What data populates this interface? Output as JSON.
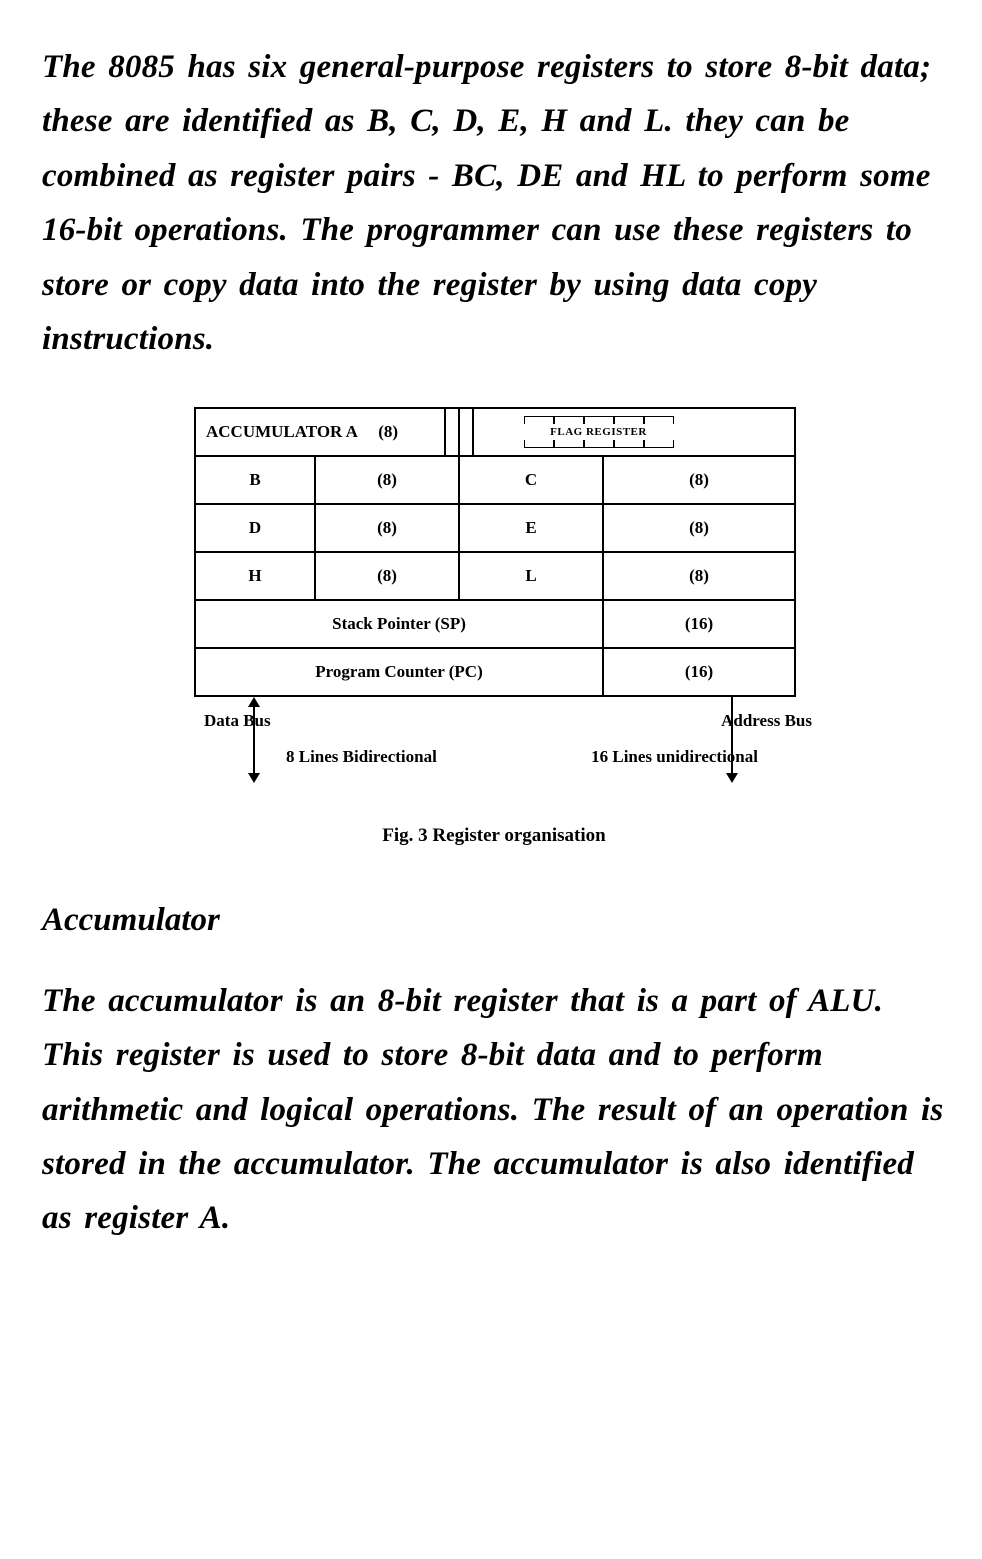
{
  "para1": "The 8085 has six general-purpose registers to store 8-bit data; these are identified as B, C, D, E, H and L. they can be combined as register pairs - BC, DE and HL to perform some 16-bit operations. The programmer can use these registers to store or copy data into the register by using data copy instructions.",
  "diagram": {
    "row1": {
      "accumulator_label": "ACCUMULATOR  A",
      "accumulator_bits": "(8)",
      "flag_label": "FLAG REGISTER"
    },
    "pairs": [
      {
        "left_name": "B",
        "left_bits": "(8)",
        "right_name": "C",
        "right_bits": "(8)"
      },
      {
        "left_name": "D",
        "left_bits": "(8)",
        "right_name": "E",
        "right_bits": "(8)"
      },
      {
        "left_name": "H",
        "left_bits": "(8)",
        "right_name": "L",
        "right_bits": "(8)"
      }
    ],
    "sp": {
      "label": "Stack Pointer (SP)",
      "bits": "(16)"
    },
    "pc": {
      "label": "Program Counter (PC)",
      "bits": "(16)"
    },
    "bus": {
      "data_bus": "Data Bus",
      "address_bus": "Address Bus",
      "lines_left": "8 Lines Bidirectional",
      "lines_right": "16 Lines unidirectional"
    },
    "caption": "Fig. 3 Register organisation"
  },
  "heading": "Accumulator",
  "para2": "The accumulator is an 8-bit register that is a part of ALU. This register is used to store 8-bit data and to perform arithmetic and logical operations. The result of an operation is stored in the accumulator. The accumulator is also identified as register A."
}
